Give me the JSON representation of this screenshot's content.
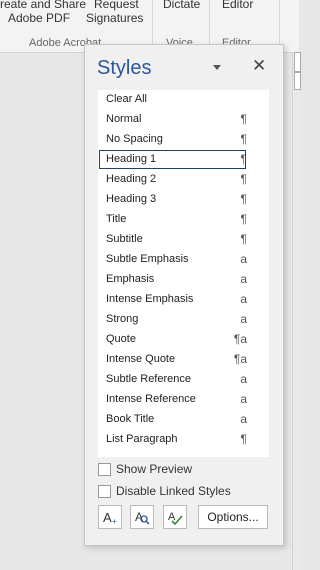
{
  "ribbon": {
    "create_share_line1": "reate and Share",
    "create_share_line2": "Adobe PDF",
    "request_line1": "Request",
    "request_line2": "Signatures",
    "dictate": "Dictate",
    "editor": "Editor",
    "group_adobe": "Adobe Acrobat",
    "group_voice": "Voice",
    "group_editor": "Editor"
  },
  "pane": {
    "title": "Styles",
    "styles": [
      {
        "label": "Clear All",
        "symbol": ""
      },
      {
        "label": "Normal",
        "symbol": "¶"
      },
      {
        "label": "No Spacing",
        "symbol": "¶"
      },
      {
        "label": "Heading 1",
        "symbol": "¶"
      },
      {
        "label": "Heading 2",
        "symbol": "¶"
      },
      {
        "label": "Heading 3",
        "symbol": "¶"
      },
      {
        "label": "Title",
        "symbol": "¶"
      },
      {
        "label": "Subtitle",
        "symbol": "¶"
      },
      {
        "label": "Subtle Emphasis",
        "symbol": "a"
      },
      {
        "label": "Emphasis",
        "symbol": "a"
      },
      {
        "label": "Intense Emphasis",
        "symbol": "a"
      },
      {
        "label": "Strong",
        "symbol": "a"
      },
      {
        "label": "Quote",
        "symbol": "¶a"
      },
      {
        "label": "Intense Quote",
        "symbol": "¶a"
      },
      {
        "label": "Subtle Reference",
        "symbol": "a"
      },
      {
        "label": "Intense Reference",
        "symbol": "a"
      },
      {
        "label": "Book Title",
        "symbol": "a"
      },
      {
        "label": "List Paragraph",
        "symbol": "¶"
      }
    ],
    "selected_style": "Heading 1",
    "show_preview": "Show Preview",
    "disable_linked": "Disable Linked Styles",
    "options_button": "Options...",
    "icons": [
      "new-style-icon",
      "style-inspector-icon",
      "manage-styles-icon"
    ],
    "accent": "#2b579a"
  }
}
